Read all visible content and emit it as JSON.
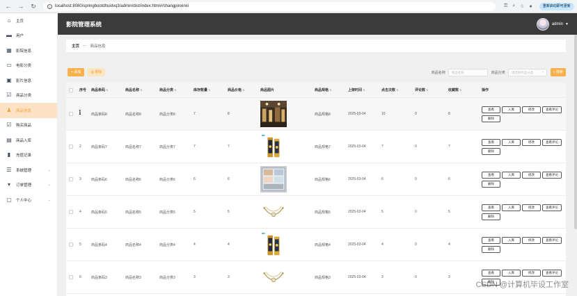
{
  "browser": {
    "url": "localhost:8080/springbootdhuidvq3/admin/dist/index.html#/shangpinxinxi",
    "relaunch_label": "重新启动即可更新"
  },
  "header": {
    "title": "影院管理系统",
    "username": "admin"
  },
  "sidebar": {
    "items": [
      {
        "label": "主页",
        "icon": "home-icon"
      },
      {
        "label": "用户",
        "icon": "monitor-icon"
      },
      {
        "label": "影院信息",
        "icon": "grid-icon"
      },
      {
        "label": "电影分类",
        "icon": "folder-icon"
      },
      {
        "label": "影片信息",
        "icon": "film-icon"
      },
      {
        "label": "商品分类",
        "icon": "check-square-icon"
      },
      {
        "label": "商品信息",
        "icon": "person-icon",
        "active": true
      },
      {
        "label": "购买商品",
        "icon": "check-square-icon"
      },
      {
        "label": "商品入库",
        "icon": "box-icon"
      },
      {
        "label": "充值记录",
        "icon": "chart-icon"
      },
      {
        "label": "系统管理",
        "icon": "list-icon",
        "expandable": true
      },
      {
        "label": "订单管理",
        "icon": "cup-icon",
        "expandable": true
      },
      {
        "label": "个人中心",
        "icon": "card-icon",
        "expandable": true
      }
    ]
  },
  "breadcrumb": {
    "home": "主页",
    "separator": "—",
    "current": "商品信息"
  },
  "toolbar": {
    "add_label": "+ 添加",
    "delete_label": "删除",
    "name_label": "商品名称",
    "name_placeholder": "商品名称",
    "category_label": "商品分类",
    "category_placeholder": "请选择商品分类",
    "search_label": "搜索"
  },
  "table": {
    "columns": [
      "序号",
      "商品条码",
      "商品名称",
      "商品分类",
      "库存数量",
      "商品价格",
      "商品图片",
      "商品规格",
      "上架时间",
      "点击次数",
      "评论数",
      "收藏数",
      "操作"
    ],
    "ops": [
      "查看",
      "入库",
      "修改",
      "查看评论",
      "删除"
    ],
    "rows": [
      {
        "no": "1",
        "code": "商品条码8",
        "name": "商品名称8",
        "category": "商品分类8",
        "stock": "7",
        "price": "8",
        "image": "cinema-lobby",
        "spec": "商品规格8",
        "time": "2025-03-04",
        "clicks": "10",
        "comments": "0",
        "fav": "8"
      },
      {
        "no": "2",
        "code": "商品条码7",
        "name": "商品名称7",
        "category": "商品分类7",
        "stock": "7",
        "price": "7",
        "image": "gift-box",
        "spec": "商品规格7",
        "time": "2025-03-04",
        "clicks": "7",
        "comments": "0",
        "fav": "7"
      },
      {
        "no": "3",
        "code": "商品条码6",
        "name": "商品名称6",
        "category": "商品分类6",
        "stock": "6",
        "price": "6",
        "image": "vending-machine",
        "spec": "商品规格6",
        "time": "2025-03-04",
        "clicks": "6",
        "comments": "0",
        "fav": "6"
      },
      {
        "no": "4",
        "code": "商品条码5",
        "name": "商品名称5",
        "category": "商品分类5",
        "stock": "5",
        "price": "5",
        "image": "bracelet",
        "spec": "商品规格5",
        "time": "2025-03-04",
        "clicks": "5",
        "comments": "0",
        "fav": "5"
      },
      {
        "no": "5",
        "code": "商品条码4",
        "name": "商品名称4",
        "category": "商品分类4",
        "stock": "4",
        "price": "4",
        "image": "gift-box",
        "spec": "商品规格4",
        "time": "2025-03-04",
        "clicks": "4",
        "comments": "0",
        "fav": "4"
      },
      {
        "no": "6",
        "code": "商品条码3",
        "name": "商品名称3",
        "category": "商品分类3",
        "stock": "3",
        "price": "3",
        "image": "bracelet",
        "spec": "商品规格3",
        "time": "2025-03-04",
        "clicks": "3",
        "comments": "0",
        "fav": "3"
      }
    ]
  },
  "watermark": "CSDN @计算机毕设工作室",
  "colors": {
    "accent": "#f7b04b",
    "active_bg": "#fde3c5",
    "topbar": "#3b3b3b"
  }
}
